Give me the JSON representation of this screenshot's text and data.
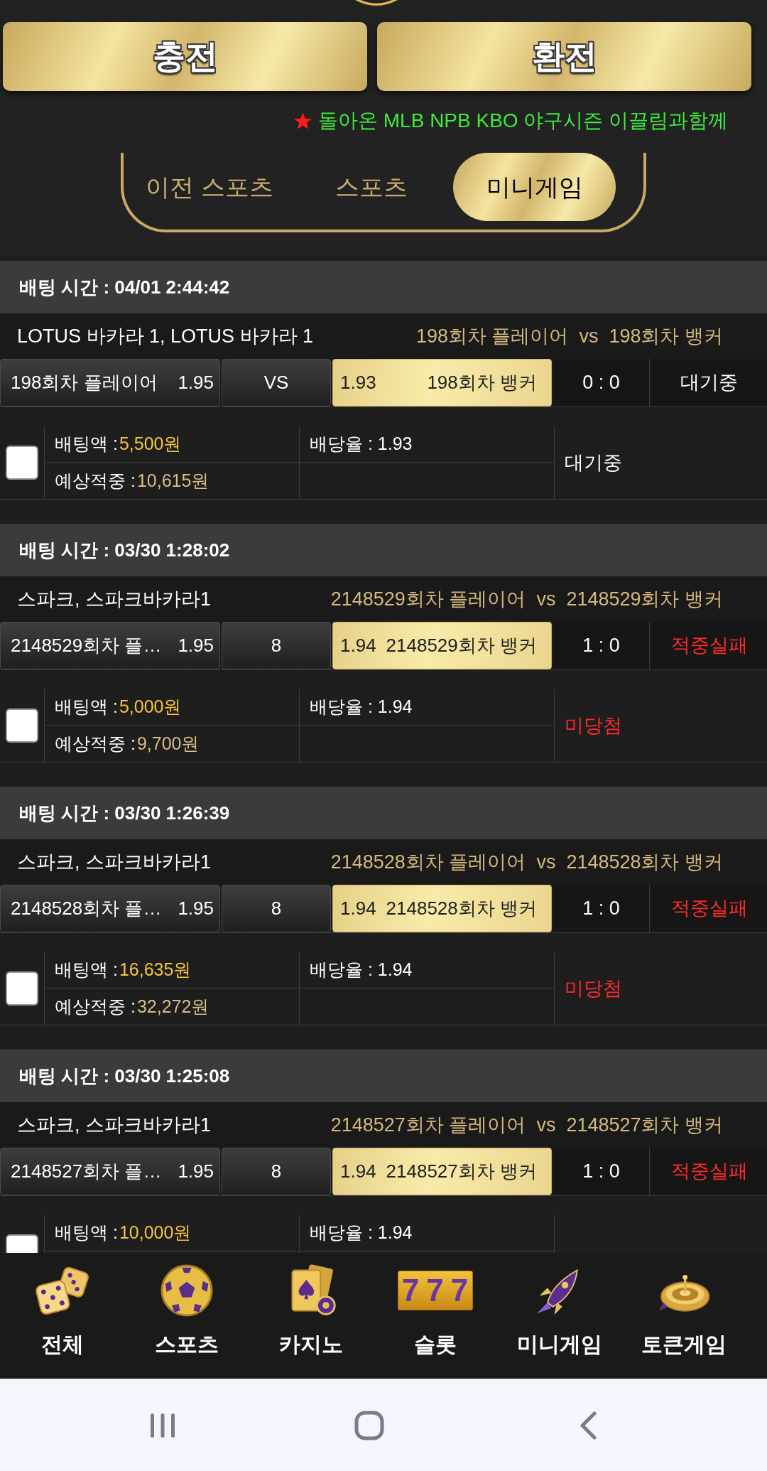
{
  "action_buttons": [
    {
      "label": "충전"
    },
    {
      "label": "환전"
    }
  ],
  "notice": {
    "text": "돌아온 MLB NPB KBO 야구시즌 이끌림과함께"
  },
  "tabs": [
    {
      "label": "이전 스포츠",
      "selected": false
    },
    {
      "label": "스포츠",
      "selected": false
    },
    {
      "label": "미니게임",
      "selected": true
    }
  ],
  "bets": [
    {
      "time_label": "배팅 시간 : 04/01 2:44:42",
      "game": "LOTUS 바카라 1, LOTUS 바카라 1",
      "matchup": "198회차 플레이어  vs  198회차 뱅커",
      "picks": [
        {
          "label": "198회차 플레이어",
          "odds": "1.95",
          "selected": false
        },
        {
          "label": "198회차 뱅커",
          "odds": "1.93",
          "selected": true
        }
      ],
      "middle": "VS",
      "score": "0 : 0",
      "result": {
        "text": "대기중",
        "kind": "pending"
      },
      "checked": false,
      "stake": {
        "label": "배팅액 :",
        "value": "5,500원"
      },
      "payout": "배당율 : 1.93",
      "expected": {
        "label": "예상적중 :",
        "value": "10,615원"
      },
      "status": {
        "text": "대기중",
        "kind": "pending"
      }
    },
    {
      "time_label": "배팅 시간 : 03/30 1:28:02",
      "game": "스파크, 스파크바카라1",
      "matchup": "2148529회차 플레이어  vs  2148529회차 뱅커",
      "picks": [
        {
          "label": "2148529회차 플…",
          "odds": "1.95",
          "selected": false
        },
        {
          "label": "2148529회차 뱅커",
          "odds": "1.94",
          "selected": true
        }
      ],
      "middle": "8",
      "score": "1 : 0",
      "result": {
        "text": "적중실패",
        "kind": "lost"
      },
      "checked": false,
      "stake": {
        "label": "배팅액 :",
        "value": "5,000원"
      },
      "payout": "배당율 : 1.94",
      "expected": {
        "label": "예상적중 :",
        "value": "9,700원"
      },
      "status": {
        "text": "미당첨",
        "kind": "lost"
      }
    },
    {
      "time_label": "배팅 시간 : 03/30 1:26:39",
      "game": "스파크, 스파크바카라1",
      "matchup": "2148528회차 플레이어  vs  2148528회차 뱅커",
      "picks": [
        {
          "label": "2148528회차 플…",
          "odds": "1.95",
          "selected": false
        },
        {
          "label": "2148528회차 뱅커",
          "odds": "1.94",
          "selected": true
        }
      ],
      "middle": "8",
      "score": "1 : 0",
      "result": {
        "text": "적중실패",
        "kind": "lost"
      },
      "checked": false,
      "stake": {
        "label": "배팅액 :",
        "value": "16,635원"
      },
      "payout": "배당율 : 1.94",
      "expected": {
        "label": "예상적중 :",
        "value": "32,272원"
      },
      "status": {
        "text": "미당첨",
        "kind": "lost"
      }
    },
    {
      "time_label": "배팅 시간 : 03/30 1:25:08",
      "game": "스파크, 스파크바카라1",
      "matchup": "2148527회차 플레이어  vs  2148527회차 뱅커",
      "picks": [
        {
          "label": "2148527회차 플…",
          "odds": "1.95",
          "selected": false
        },
        {
          "label": "2148527회차 뱅커",
          "odds": "1.94",
          "selected": true
        }
      ],
      "middle": "8",
      "score": "1 : 0",
      "result": {
        "text": "적중실패",
        "kind": "lost"
      },
      "checked": false,
      "stake": {
        "label": "배팅액 :",
        "value": "10,000원"
      },
      "payout": "배당율 : 1.94"
    }
  ],
  "bottom_nav": [
    {
      "label": "전체"
    },
    {
      "label": "스포츠"
    },
    {
      "label": "카지노"
    },
    {
      "label": "슬롯",
      "icon_text": "777"
    },
    {
      "label": "미니게임"
    },
    {
      "label": "토큰게임"
    }
  ]
}
